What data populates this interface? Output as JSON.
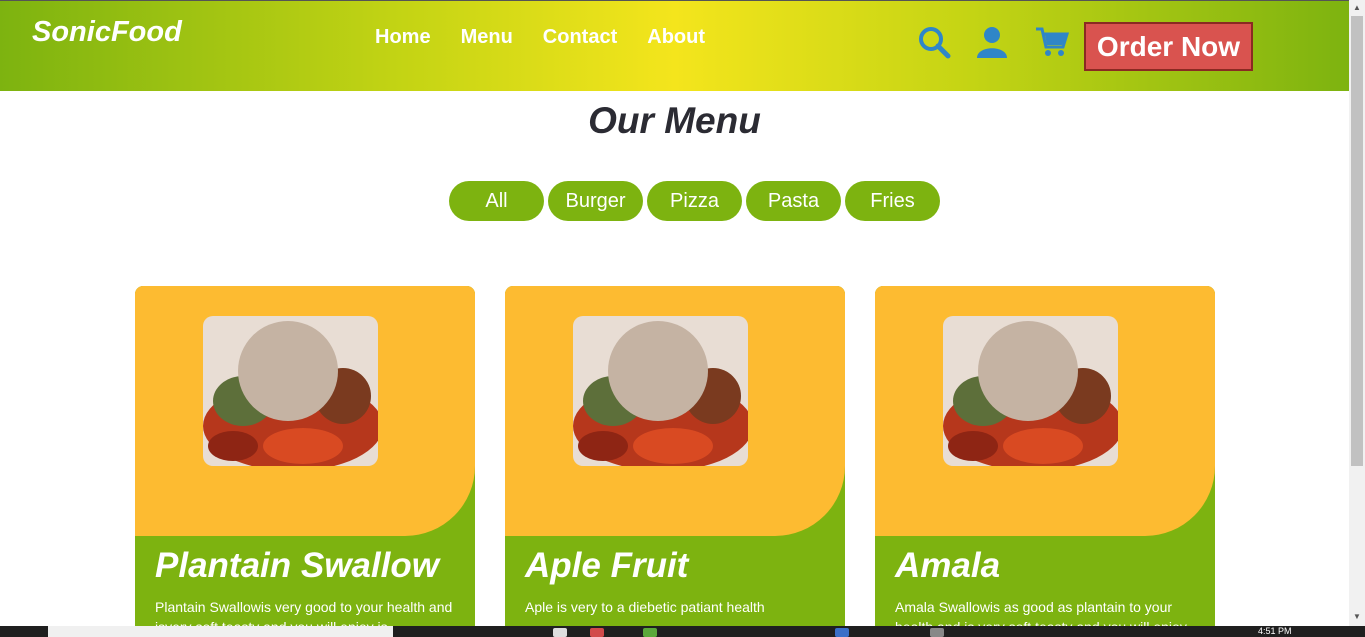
{
  "header": {
    "brand": "SonicFood",
    "nav": [
      "Home",
      "Menu",
      "Contact",
      "About"
    ],
    "icons": [
      "search-icon",
      "user-icon",
      "cart-icon"
    ],
    "order_button": "Order Now"
  },
  "menu": {
    "title": "Our Menu",
    "filters": [
      "All",
      "Burger",
      "Pizza",
      "Pasta",
      "Fries"
    ]
  },
  "cards": [
    {
      "name": "Plantain Swallow",
      "description": "Plantain Swallowis very good to your health and isvery soft teasty and you will enjoy is"
    },
    {
      "name": "Aple Fruit",
      "description": "Aple is very to a diebetic patiant health"
    },
    {
      "name": "Amala",
      "description": "Amala Swallowis as good as plantain to your health and is very soft teasty and you will enjoy"
    }
  ],
  "taskbar": {
    "clock": "4:51 PM"
  },
  "colors": {
    "accent_green": "#7db310",
    "accent_yellow": "#f4e51c",
    "card_orange": "#fdbb31",
    "order_red": "#d9534f",
    "icon_blue": "#2f86c8"
  }
}
